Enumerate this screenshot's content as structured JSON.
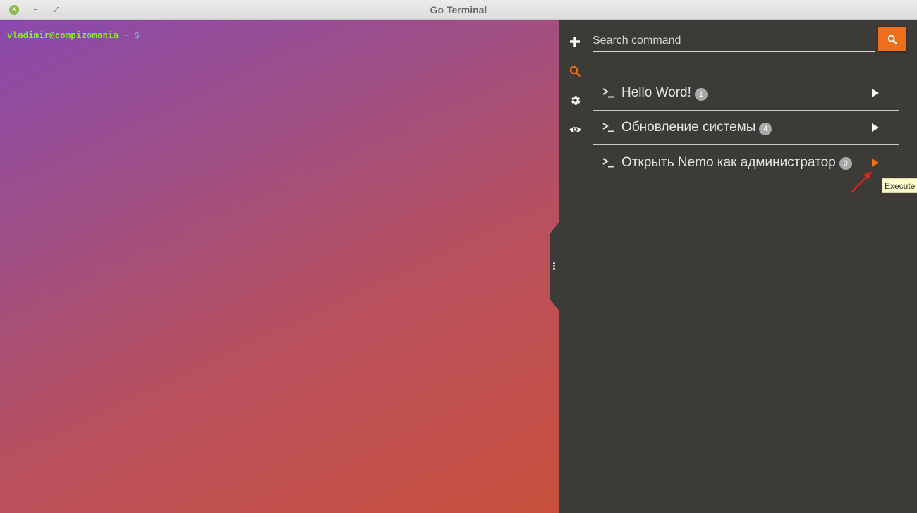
{
  "window": {
    "title": "Go Terminal",
    "controls": [
      "close-icon",
      "minimize-icon",
      "maximize-icon"
    ]
  },
  "terminal": {
    "user_host": "vladimir@compizomania",
    "path": "~",
    "symbol": "$"
  },
  "sidebar": {
    "icons": [
      "plus-icon",
      "search-icon",
      "gear-icon",
      "eye-icon"
    ],
    "active_icon": "search-icon"
  },
  "search": {
    "placeholder": "Search command",
    "button_icon": "search-icon"
  },
  "commands": [
    {
      "label": "Hello Word!",
      "count": "1"
    },
    {
      "label": "Обновление системы",
      "count": "4"
    },
    {
      "label": "Открыть Nemo как администратор",
      "count": "0"
    }
  ],
  "tooltip": {
    "text": "Execute"
  },
  "colors": {
    "accent": "#f06d1a",
    "panel_bg": "#3c3b37",
    "prompt_user": "#8ae234",
    "annotation": "#e2231a"
  }
}
